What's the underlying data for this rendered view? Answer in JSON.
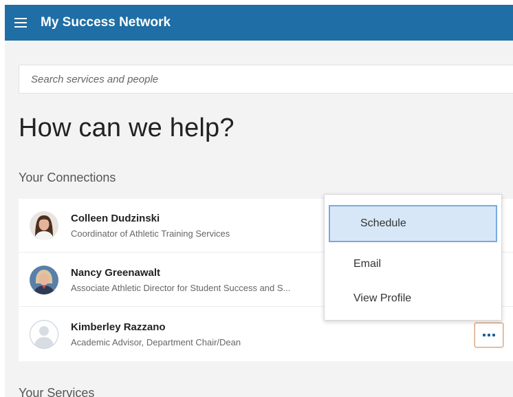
{
  "header": {
    "title": "My Success Network"
  },
  "search": {
    "placeholder": "Search services and people"
  },
  "main": {
    "page_title": "How can we help?",
    "connections_title": "Your Connections",
    "services_title": "Your Services"
  },
  "connections": [
    {
      "name": "Colleen Dudzinski",
      "role": "Coordinator of Athletic Training Services",
      "avatar": "photo"
    },
    {
      "name": "Nancy Greenawalt",
      "role": "Associate Athletic Director for Student Success and S...",
      "avatar": "photo"
    },
    {
      "name": "Kimberley Razzano",
      "role": "Academic Advisor, Department Chair/Dean",
      "avatar": "placeholder-person-icon"
    }
  ],
  "menu": {
    "items": [
      {
        "label": "Schedule",
        "selected": true
      },
      {
        "label": "Email",
        "selected": false
      },
      {
        "label": "View Profile",
        "selected": false
      }
    ]
  },
  "icons": {
    "menu": "hamburger-icon",
    "more": "more-horizontal-icon"
  },
  "colors": {
    "header_bg": "#1f6ea5",
    "selected_bg": "#d7e7f7",
    "selected_border": "#7aa8e0",
    "more_button_border": "#d9a47f"
  }
}
